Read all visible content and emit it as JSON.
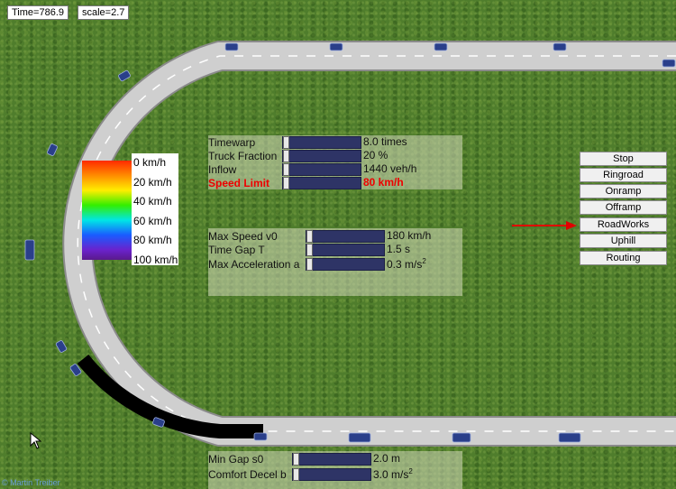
{
  "info": {
    "time": "Time=786.9",
    "scale": "scale=2.7"
  },
  "panel_top": {
    "rows": [
      {
        "label": "Timewarp",
        "value": "8.0 times",
        "level": 0.0
      },
      {
        "label": "Truck Fraction",
        "value": "20 %",
        "level": 0.0
      },
      {
        "label": "Inflow",
        "value": "1440 veh/h",
        "level": 0.0
      },
      {
        "label": "Speed Limit",
        "value": "80 km/h",
        "level": 0.0,
        "highlight": "#e00000"
      }
    ]
  },
  "panel_mid": {
    "rows": [
      {
        "label": "Max Speed v0",
        "value": "180 km/h"
      },
      {
        "label": "Time Gap T",
        "value": "1.5 s"
      },
      {
        "label": "Max Acceleration a",
        "value": "0.3 m/s",
        "sup": "2"
      }
    ]
  },
  "panel_bottom": {
    "rows": [
      {
        "label": "Min Gap s0",
        "value": "2.0 m"
      },
      {
        "label": "Comfort Decel b",
        "value": "3.0 m/s",
        "sup": "2"
      }
    ]
  },
  "legend": {
    "labels": [
      "0 km/h",
      "20 km/h",
      "40 km/h",
      "60 km/h",
      "80 km/h",
      "100 km/h"
    ]
  },
  "buttons": [
    "Stop",
    "Ringroad",
    "Onramp",
    "Offramp",
    "RoadWorks",
    "Uphill",
    "Routing"
  ],
  "credit": "© Martin Treiber",
  "colors": {
    "road": "#c9c9c9",
    "roadworks": "#000000",
    "vehicle": "#2a3f8a",
    "arrow": "#e00000"
  }
}
